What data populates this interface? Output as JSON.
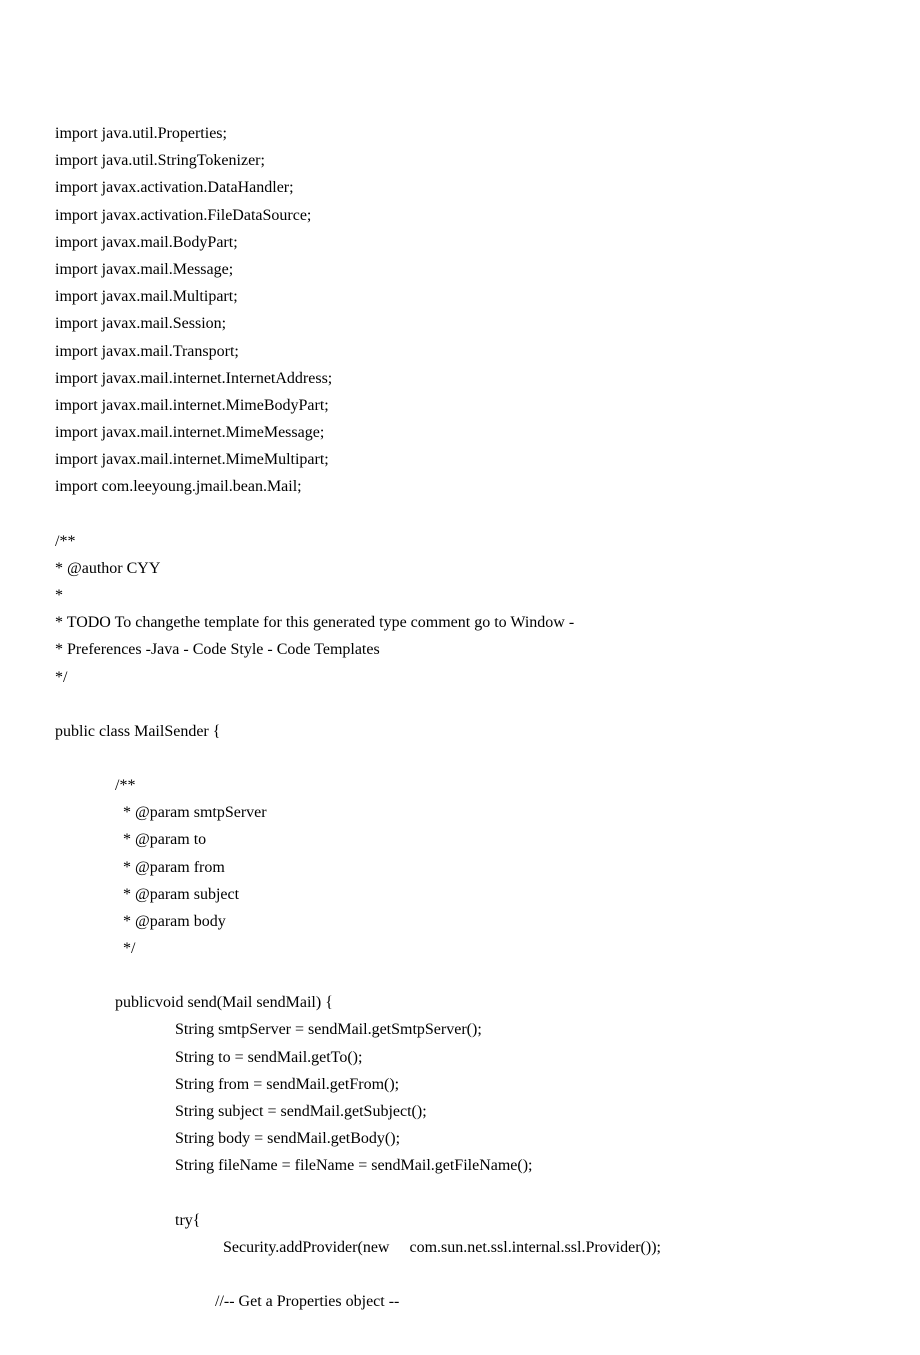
{
  "lines": [
    "import java.util.Properties;",
    "import java.util.StringTokenizer;",
    "import javax.activation.DataHandler;",
    "import javax.activation.FileDataSource;",
    "import javax.mail.BodyPart;",
    "import javax.mail.Message;",
    "import javax.mail.Multipart;",
    "import javax.mail.Session;",
    "import javax.mail.Transport;",
    "import javax.mail.internet.InternetAddress;",
    "import javax.mail.internet.MimeBodyPart;",
    "import javax.mail.internet.MimeMessage;",
    "import javax.mail.internet.MimeMultipart;",
    "import com.leeyoung.jmail.bean.Mail;",
    "",
    "/**",
    "* @author CYY",
    "*",
    "* TODO To changethe template for this generated type comment go to Window -",
    "* Preferences -Java - Code Style - Code Templates",
    "*/",
    "",
    "public class MailSender {",
    "",
    "               /**",
    "                 * @param smtpServer",
    "                 * @param to",
    "                 * @param from",
    "                 * @param subject",
    "                 * @param body",
    "                 */",
    "",
    "               publicvoid send(Mail sendMail) {",
    "                              String smtpServer = sendMail.getSmtpServer();",
    "                              String to = sendMail.getTo();",
    "                              String from = sendMail.getFrom();",
    "                              String subject = sendMail.getSubject();",
    "                              String body = sendMail.getBody();",
    "                              String fileName = fileName = sendMail.getFileName();",
    "",
    "                              try{",
    "                                          Security.addProvider(new     com.sun.net.ssl.internal.ssl.Provider());",
    "",
    "                                        //-- Get a Properties object --"
  ]
}
